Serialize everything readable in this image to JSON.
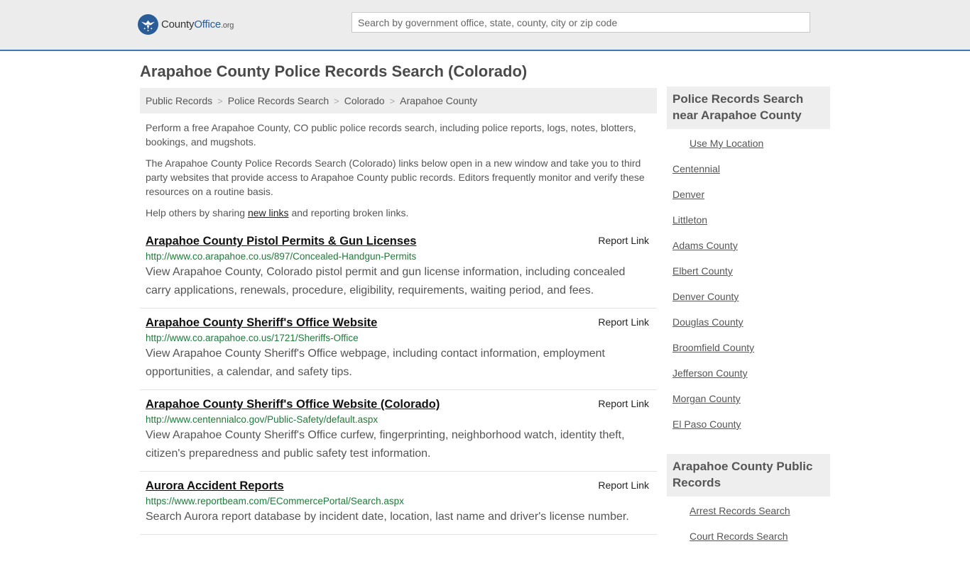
{
  "header": {
    "logo": {
      "name_start": "County",
      "name_accent": "Office",
      "name_end": ".org"
    },
    "search_placeholder": "Search by government office, state, county, city or zip code"
  },
  "page_title": "Arapahoe County Police Records Search (Colorado)",
  "breadcrumb": [
    "Public Records",
    "Police Records Search",
    "Colorado",
    "Arapahoe County"
  ],
  "intro": {
    "p1": "Perform a free Arapahoe County, CO public police records search, including police reports, logs, notes, blotters, bookings, and mugshots.",
    "p2": "The Arapahoe County Police Records Search (Colorado) links below open in a new window and take you to third party websites that provide access to Arapahoe County public records. Editors frequently monitor and verify these resources on a routine basis.",
    "p3_before": "Help others by sharing ",
    "p3_link": "new links",
    "p3_after": " and reporting broken links."
  },
  "report_link_label": "Report Link",
  "results": [
    {
      "title": "Arapahoe County Pistol Permits & Gun Licenses",
      "url": "http://www.co.arapahoe.co.us/897/Concealed-Handgun-Permits",
      "description": "View Arapahoe County, Colorado pistol permit and gun license information, including concealed carry applications, renewals, procedure, eligibility, requirements, waiting period, and fees."
    },
    {
      "title": "Arapahoe County Sheriff's Office Website",
      "url": "http://www.co.arapahoe.co.us/1721/Sheriffs-Office",
      "description": "View Arapahoe County Sheriff's Office webpage, including contact information, employment opportunities, a calendar, and safety tips."
    },
    {
      "title": "Arapahoe County Sheriff's Office Website (Colorado)",
      "url": "http://www.centennialco.gov/Public-Safety/default.aspx",
      "description": "View Arapahoe County Sheriff's Office curfew, fingerprinting, neighborhood watch, identity theft, citizen's preparedness and public safety test information."
    },
    {
      "title": "Aurora Accident Reports",
      "url": "https://www.reportbeam.com/ECommercePortal/Search.aspx",
      "description": "Search Aurora report database by incident date, location, last name and driver's license number."
    }
  ],
  "sidebar": {
    "nearby_heading": "Police Records Search near Arapahoe County",
    "use_location": "Use My Location",
    "nearby": [
      "Centennial",
      "Denver",
      "Littleton",
      "Adams County",
      "Elbert County",
      "Denver County",
      "Douglas County",
      "Broomfield County",
      "Jefferson County",
      "Morgan County",
      "El Paso County"
    ],
    "public_heading": "Arapahoe County Public Records",
    "public_records": [
      "Arrest Records Search",
      "Court Records Search"
    ]
  },
  "colors": {
    "accent": "#3f78b5",
    "link_green": "#1f7a3a",
    "panel_bg": "#eeeeee"
  }
}
